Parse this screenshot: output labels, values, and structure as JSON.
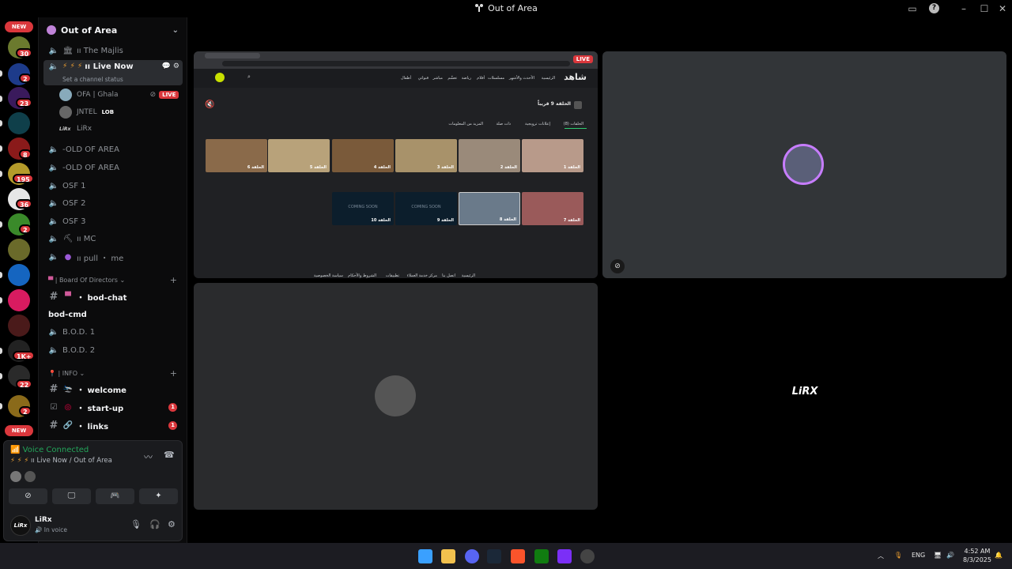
{
  "window": {
    "title": "Out of Area"
  },
  "servers": {
    "new_top": "NEW",
    "new_bottom": "NEW",
    "badges": [
      "30",
      "2",
      "23",
      "8",
      "195",
      "36",
      "2",
      "1K+",
      "22",
      "2"
    ]
  },
  "server_header": {
    "name": "Out of Area"
  },
  "channels": {
    "majlis": "ıı The Majlis",
    "live_now": "ıı Live Now",
    "live_status": "Set a channel status",
    "user1": "OFA | Ghala",
    "user1_tag": "LIVE",
    "user2": "JNTEL",
    "user2_tag": "LOB",
    "user3": "LiRx",
    "old1": "-OLD OF AREA",
    "old2": "-OLD OF AREA",
    "osf1": "OSF 1",
    "osf2": "OSF 2",
    "osf3": "OSF 3",
    "mc": "ıı MC",
    "pull": "ıı pull ・ me",
    "cat_bod": "| Board Of Directors",
    "bod_chat": "・ bod-chat",
    "bod_cmd": "bod-cmd",
    "bod1": "B.O.D. 1",
    "bod2": "B.O.D. 2",
    "cat_info": "| INFO",
    "welcome": "・ welcome",
    "startup": "・ start-up",
    "startup_badge": "1",
    "links": "・ links",
    "links_badge": "1"
  },
  "voice": {
    "status": "Voice Connected",
    "location": "ıı Live Now / Out of Area"
  },
  "me": {
    "name": "LiRx",
    "status": "In voice",
    "avatar_text": "LiRx"
  },
  "stream": {
    "live_badge": "LIVE",
    "site_logo": "شاهد",
    "nav": [
      "الرئيسية",
      "الأحدث والأشهر",
      "مسلسلات",
      "أفلام",
      "رياضة",
      "تعشّم",
      "مباشر",
      "قنواتي",
      "أطفال"
    ],
    "episode_title": "الحلقة 9 قريباً",
    "tabs": [
      "الحلقات (8)",
      "إعلانات ترويجية",
      "ذات صلة",
      "المزيد من المعلومات"
    ],
    "row1": [
      "الحلقة 1",
      "الحلقة 2",
      "الحلقة 3",
      "الحلقة 4",
      "الحلقة 5",
      "الحلقة 6"
    ],
    "row2": [
      "الحلقة 7",
      "الحلقة 8",
      "الحلقة 9",
      "الحلقة 10"
    ],
    "coming_soon": "COMING SOON",
    "footer": [
      "الرئيسية",
      "اتصل بنا",
      "مركز خدمة العملاء",
      "تطبيقات",
      "الشروط والأحكام",
      "سياسة الخصوصية"
    ]
  },
  "tile_d": {
    "logo": "LiRX"
  },
  "taskbar": {
    "lang": "ENG",
    "time": "4:52 AM",
    "date": "8/3/2025"
  }
}
